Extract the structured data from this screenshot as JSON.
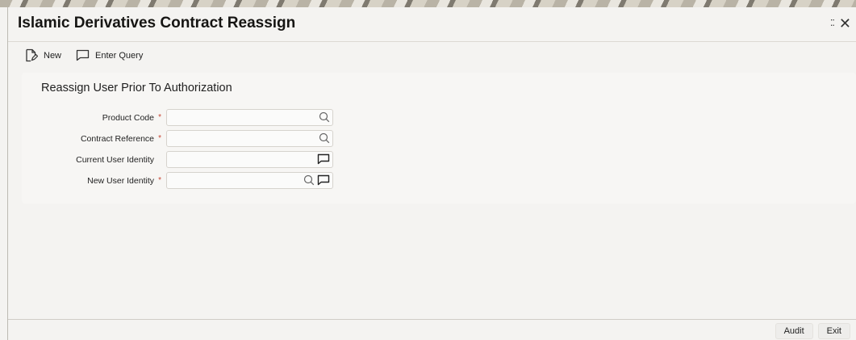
{
  "window": {
    "title": "Islamic Derivatives Contract Reassign",
    "expand_icon": "expand-icon",
    "close_icon": "close-icon"
  },
  "toolbar": {
    "new_label": "New",
    "enter_query_label": "Enter Query"
  },
  "section": {
    "title": "Reassign User Prior To Authorization"
  },
  "fields": {
    "product_code": {
      "label": "Product Code",
      "required": "*",
      "value": ""
    },
    "contract_reference": {
      "label": "Contract Reference",
      "required": "*",
      "value": ""
    },
    "current_user_identity": {
      "label": "Current User Identity",
      "value": ""
    },
    "new_user_identity": {
      "label": "New User Identity",
      "required": "*",
      "value": ""
    }
  },
  "footer": {
    "audit_label": "Audit",
    "exit_label": "Exit"
  },
  "colors": {
    "required_asterisk": "#c74634",
    "background": "#f4f3f1"
  }
}
